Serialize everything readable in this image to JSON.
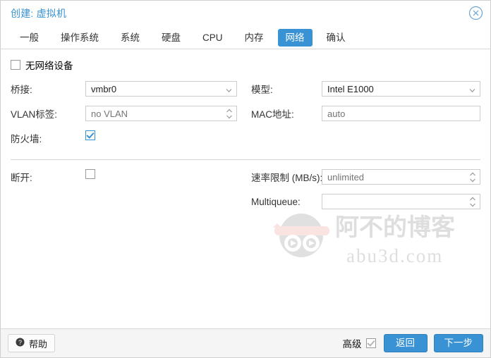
{
  "dialog": {
    "title": "创建: 虚拟机",
    "close_icon": "close-circle-icon"
  },
  "tabs": [
    {
      "label": "一般",
      "active": false
    },
    {
      "label": "操作系统",
      "active": false
    },
    {
      "label": "系统",
      "active": false
    },
    {
      "label": "硬盘",
      "active": false
    },
    {
      "label": "CPU",
      "active": false
    },
    {
      "label": "内存",
      "active": false
    },
    {
      "label": "网络",
      "active": true
    },
    {
      "label": "确认",
      "active": false
    }
  ],
  "form": {
    "no_network_device": {
      "label": "无网络设备",
      "checked": false
    },
    "left": {
      "bridge": {
        "label": "桥接:",
        "value": "vmbr0",
        "placeholder": "",
        "icon": "chevron-down-icon"
      },
      "vlan_tag": {
        "label": "VLAN标签:",
        "value": "",
        "placeholder": "no VLAN",
        "icon": "spinner-updown-icon"
      },
      "firewall": {
        "label": "防火墙:",
        "checked": true
      },
      "disconnect": {
        "label": "断开:",
        "checked": false
      }
    },
    "right": {
      "model": {
        "label": "模型:",
        "value": "Intel E1000",
        "placeholder": "",
        "icon": "chevron-down-icon"
      },
      "mac_address": {
        "label": "MAC地址:",
        "value": "",
        "placeholder": "auto"
      },
      "rate_limit": {
        "label": "速率限制 (MB/s):",
        "value": "",
        "placeholder": "unlimited",
        "icon": "spinner-updown-icon"
      },
      "multiqueue": {
        "label": "Multiqueue:",
        "value": "",
        "placeholder": "",
        "icon": "spinner-updown-icon"
      }
    }
  },
  "watermark": {
    "text_cn": "阿不的博客",
    "text_domain": "abu3d.com",
    "mascot": "ninja-robot-icon"
  },
  "footer": {
    "help_label": "帮助",
    "help_icon": "question-circle-icon",
    "advanced_label": "高级",
    "advanced_checked": true,
    "back_label": "返回",
    "next_label": "下一步"
  },
  "colors": {
    "accent": "#3892d4",
    "title": "#3892d4",
    "footer_bg": "#f5f5f5",
    "border": "#cccccc",
    "placeholder": "#9a9a9a"
  }
}
